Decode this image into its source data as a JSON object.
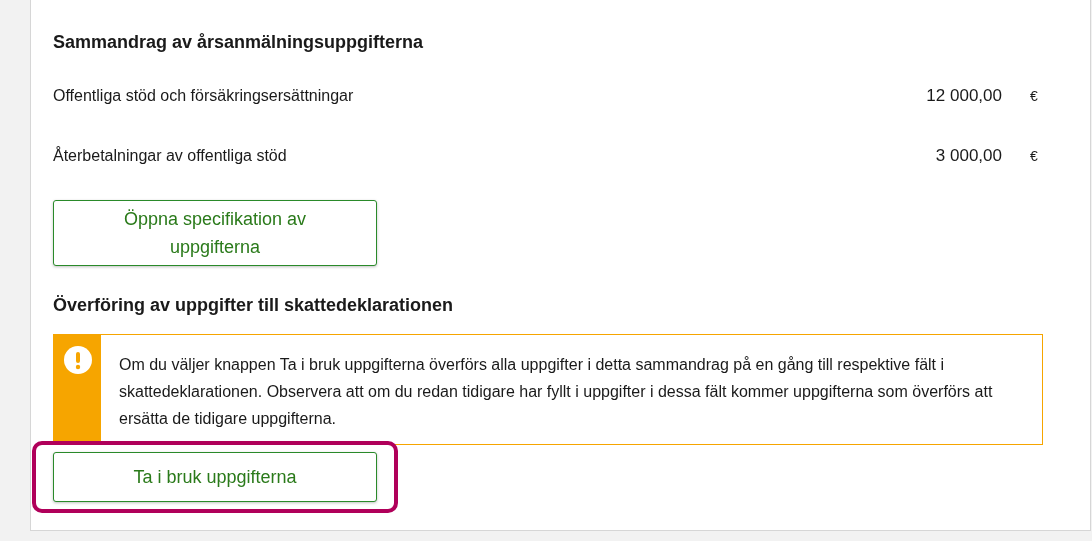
{
  "summary": {
    "title": "Sammandrag av årsanmälningsuppgifterna",
    "rows": [
      {
        "label": "Offentliga stöd och försäkringsersättningar",
        "amount": "12 000,00",
        "currency": "€"
      },
      {
        "label": "Återbetalningar av offentliga stöd",
        "amount": "3 000,00",
        "currency": "€"
      }
    ],
    "button": {
      "label": "Öppna specifikation av uppgifterna"
    }
  },
  "transfer": {
    "title": "Överföring av uppgifter till skattedeklarationen",
    "alert": {
      "kind": "warning",
      "text": "Om du väljer knappen Ta i bruk uppgifterna överförs alla uppgifter i detta sammandrag på en gång till respektive fält i skattedeklarationen. Observera att om du redan tidigare har fyllt i uppgifter i dessa fält kommer uppgifterna som överförs att ersätta de tidigare uppgifterna."
    },
    "button": {
      "label": "Ta i bruk uppgifterna",
      "highlighted": true
    }
  }
}
